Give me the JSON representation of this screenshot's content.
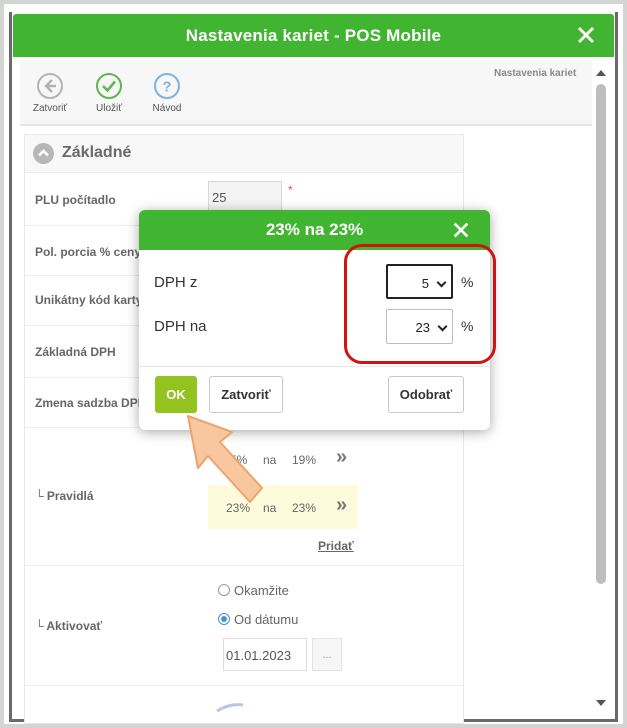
{
  "window": {
    "title": "Nastavenia kariet - POS Mobile",
    "breadcrumb": "Nastavenia kariet"
  },
  "toolbar": {
    "close_label": "Zatvoriť",
    "save_label": "Uložiť",
    "help_label": "Návod"
  },
  "section": {
    "title": "Základné"
  },
  "form": {
    "plu_label": "PLU počítadlo",
    "plu_value": "25",
    "portion_label": "Pol. porcia % ceny",
    "unique_code_label": "Unikátny kód karty",
    "base_vat_label": "Základná DPH",
    "vat_change_label": "Zmena sadzba DPH",
    "rules_label": "└ Pravidlá",
    "rules": [
      {
        "from": "5%",
        "word": "na",
        "to": "19%",
        "chevron": "»"
      },
      {
        "from": "23%",
        "word": "na",
        "to": "23%",
        "chevron": "»"
      }
    ],
    "add_label": "Pridať",
    "activate_label": "└ Aktivovať",
    "radio_now": "Okamžite",
    "radio_date": "Od dátumu",
    "date_value": "01.01.2023",
    "date_button": "..."
  },
  "dialog": {
    "title": "23% na 23%",
    "from_label": "DPH z",
    "from_value": "5",
    "to_label": "DPH na",
    "to_value": "23",
    "percent": "%",
    "ok_label": "OK",
    "close_label": "Zatvoriť",
    "remove_label": "Odobrať"
  },
  "colors": {
    "brand_green": "#41b531",
    "ok_green": "#94c21e",
    "highlight_red": "#d01212",
    "arrow_orange": "#f6b98a"
  }
}
